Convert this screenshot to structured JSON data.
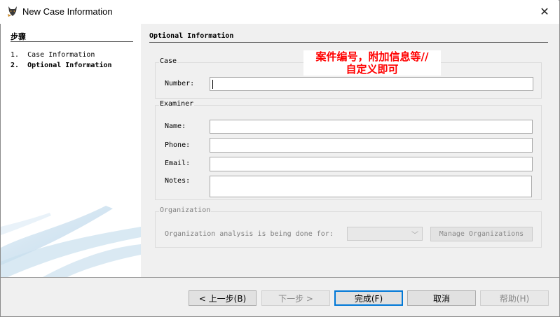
{
  "window": {
    "title": "New Case Information"
  },
  "steps": {
    "header": "步骤",
    "items": [
      {
        "num": "1.",
        "label": "Case Information"
      },
      {
        "num": "2.",
        "label": "Optional Information"
      }
    ]
  },
  "main": {
    "section_title": "Optional Information",
    "case_group": {
      "label": "Case",
      "number_label": "Number:",
      "number_value": ""
    },
    "examiner_group": {
      "label": "Examiner",
      "name_label": "Name:",
      "name_value": "",
      "phone_label": "Phone:",
      "phone_value": "",
      "email_label": "Email:",
      "email_value": "",
      "notes_label": "Notes:",
      "notes_value": ""
    },
    "organization_group": {
      "label": "Organization",
      "analysis_label": "Organization analysis is being done for:",
      "select_value": "",
      "manage_button": "Manage Organizations"
    },
    "annotation": {
      "line1": "案件编号，附加信息等//",
      "line2": "自定义即可",
      "color": "#ff0000"
    }
  },
  "footer": {
    "back": "< 上一步(B)",
    "next": "下一步 >",
    "finish": "完成(F)",
    "cancel": "取消",
    "help": "帮助(H)"
  },
  "colors": {
    "default_button_border": "#0078d7",
    "panel_bg": "#f0f0f0"
  }
}
